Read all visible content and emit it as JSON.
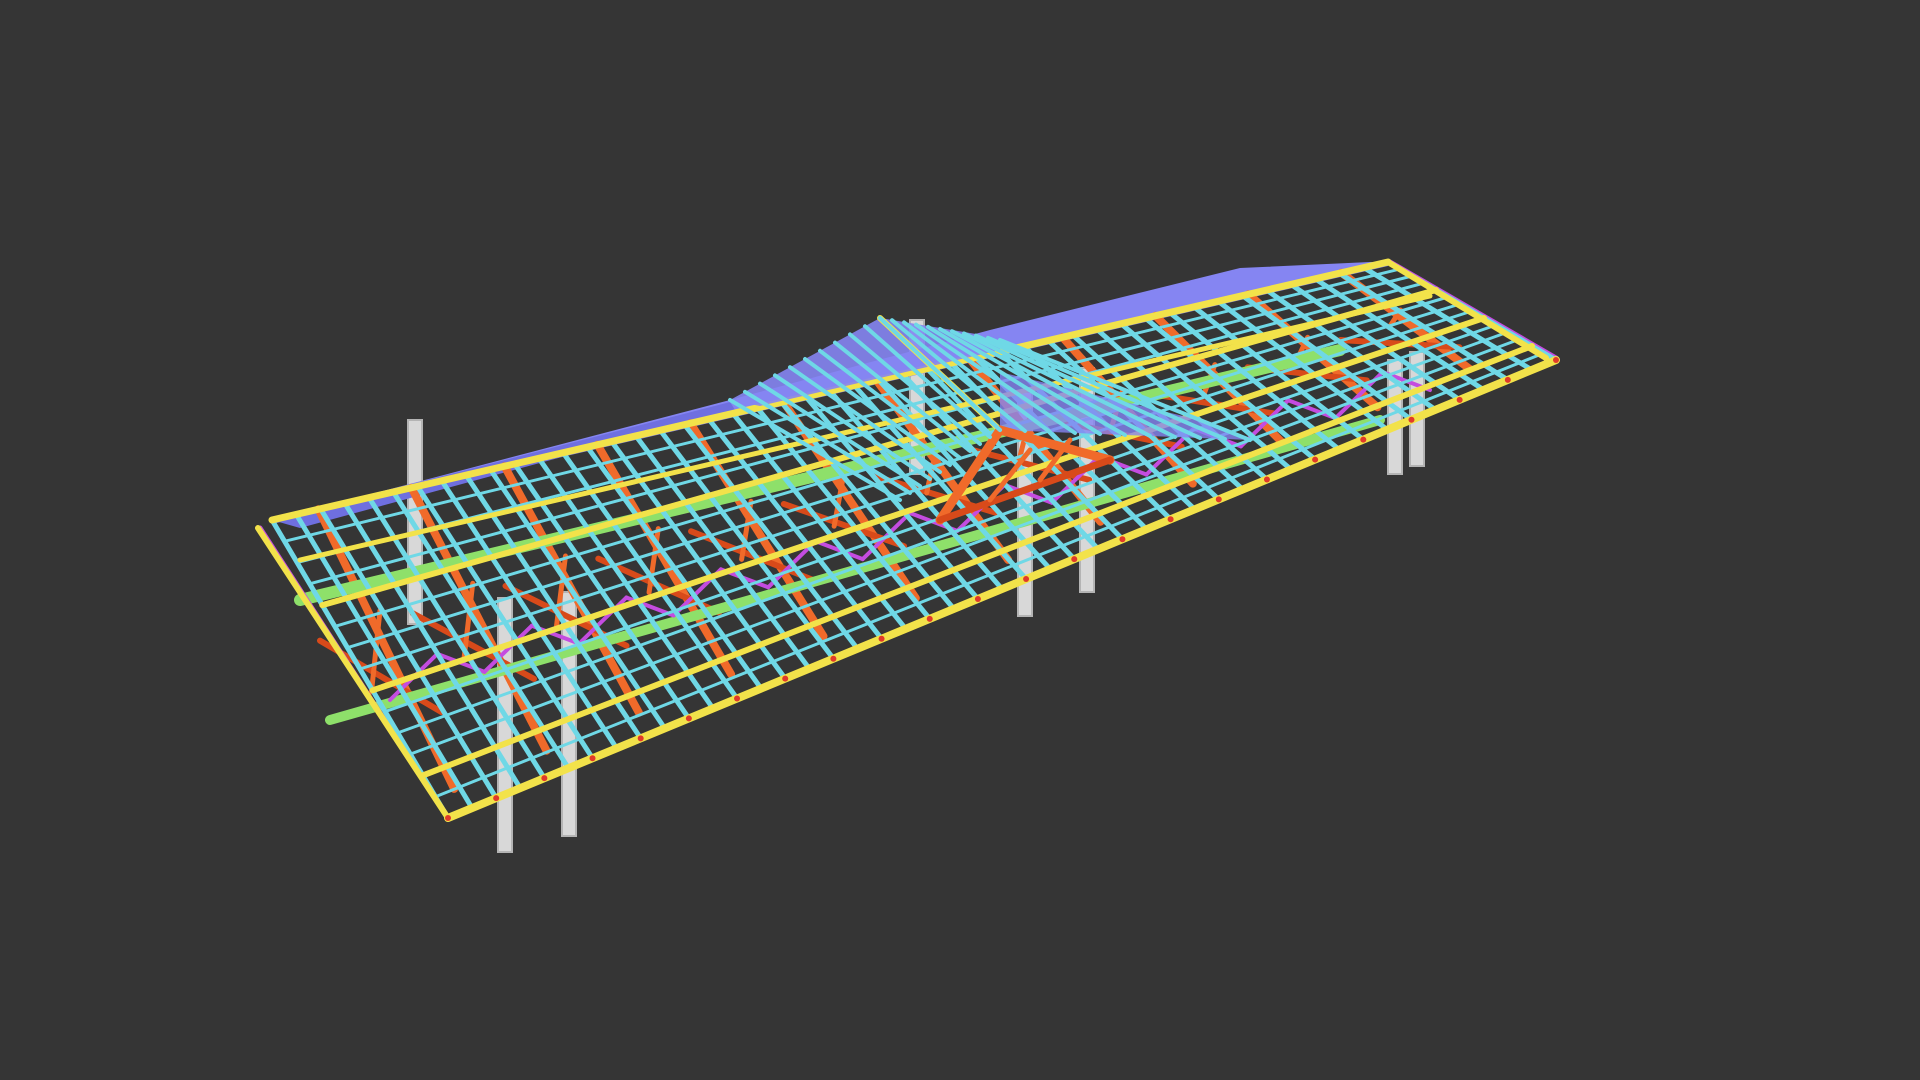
{
  "scene": {
    "background": "#353535",
    "subject": "steel-roof-structure-3d-model",
    "colors": {
      "roof_sheet": "#8585f2",
      "roof_sheet_shade": "#6f6fe0",
      "purlin": "#6fd8e6",
      "eave_beam": "#f2e24a",
      "ridge_beam": "#f2e24a",
      "truss": "#f06a2a",
      "truss_dark": "#d84a1a",
      "bracing": "#c44ce0",
      "tie_beam": "#8ee06a",
      "column": "#d8d8d8",
      "column_shade": "#b4b4b4",
      "joint": "#e03a2a"
    }
  }
}
